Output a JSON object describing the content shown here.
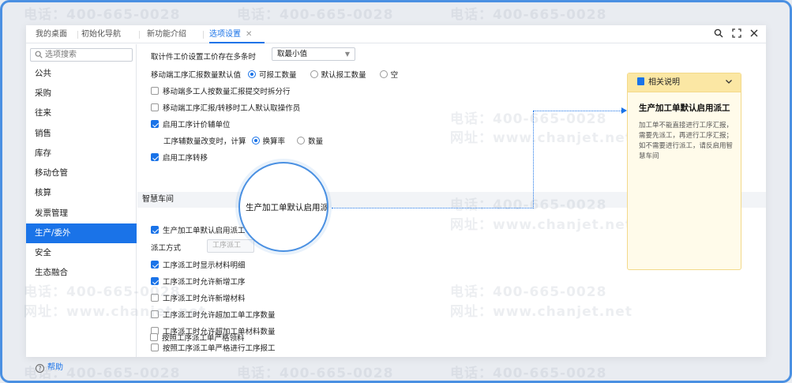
{
  "tabs": [
    {
      "label": "我的桌面"
    },
    {
      "label": "初始化导航"
    },
    {
      "label": "新功能介绍"
    },
    {
      "label": "选项设置",
      "active": true
    }
  ],
  "tab_close": "✕",
  "sidebar": {
    "search_placeholder": "选项搜索",
    "items": [
      {
        "label": "公共"
      },
      {
        "label": "采购"
      },
      {
        "label": "往来"
      },
      {
        "label": "销售"
      },
      {
        "label": "库存"
      },
      {
        "label": "移动仓管"
      },
      {
        "label": "核算"
      },
      {
        "label": "发票管理"
      },
      {
        "label": "生产/委外",
        "active": true
      },
      {
        "label": "安全"
      },
      {
        "label": "生态融合"
      }
    ],
    "help_label": "帮助"
  },
  "settings": {
    "price_rule_label": "取计件工价设置工价存在多条时",
    "price_rule_value": "取最小值",
    "mobile_qty_label": "移动端工序汇报数量默认值",
    "mobile_qty_options": [
      "可报工数量",
      "默认报工数量",
      "空"
    ],
    "checkboxes_top": [
      {
        "label": "移动端多工人按数量汇报提交时拆分行",
        "checked": false
      },
      {
        "label": "移动端工序汇报/转移时工人默认取操作员",
        "checked": false
      },
      {
        "label": "启用工序计价辅单位",
        "checked": true
      }
    ],
    "aux_change_label": "工序辅数量改变时，计算",
    "aux_change_options": [
      "换算率",
      "数量"
    ],
    "enable_transfer": {
      "label": "启用工序转移",
      "checked": true
    },
    "section_title": "智慧车间",
    "enable_dispatch": {
      "label": "生产加工单默认启用派工",
      "checked": true
    },
    "dispatch_mode_label": "派工方式",
    "dispatch_mode_value": "工序派工",
    "checkboxes_bottom": [
      {
        "label": "工序派工时显示材料明细",
        "checked": true
      },
      {
        "label": "工序派工时允许新增工序",
        "checked": true
      },
      {
        "label": "工序派工时允许新增材料",
        "checked": false
      },
      {
        "label": "工序派工时允许超加工单工序数量",
        "checked": false
      },
      {
        "label": "工序派工时允许超加工单材料数量",
        "checked": false
      },
      {
        "label": "按照工序派工单严格进行工序报工",
        "checked": false
      },
      {
        "label": "按照工序派工单严格领料",
        "checked": false
      }
    ]
  },
  "magnifier_text": "生产加工单默认启用派工",
  "note": {
    "header": "相关说明",
    "title": "生产加工单默认启用派工",
    "body": "加工单不能直接进行工序汇报，需要先派工，再进行工序汇报；如不需要进行派工，请反启用智慧车间"
  },
  "watermark": {
    "phone": "电话：400-665-0028",
    "site": "网址：www.chanjet.net"
  },
  "colors": {
    "accent": "#1a73e8",
    "frame": "#4a90e2",
    "note_bg": "#fffbea"
  }
}
